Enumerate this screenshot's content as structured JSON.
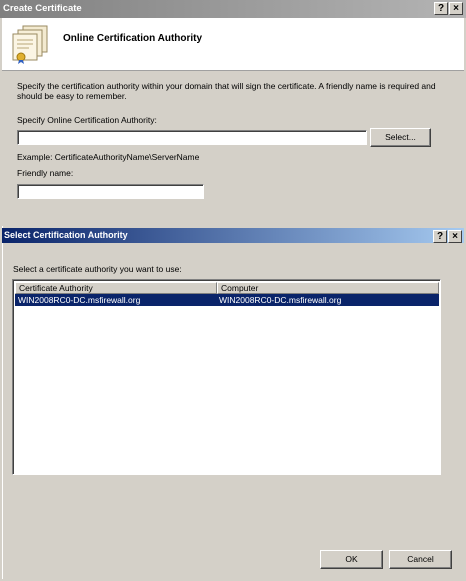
{
  "outer": {
    "title": "Create Certificate",
    "help_glyph": "?",
    "close_glyph": "×",
    "header_title": "Online Certification Authority",
    "description": "Specify the certification authority within your domain that will sign the certificate. A friendly name is required and should be easy to remember.",
    "ca_label": "Specify Online Certification Authority:",
    "ca_value": "",
    "select_button": "Select...",
    "example": "Example: CertificateAuthorityName\\ServerName",
    "friendly_label": "Friendly name:",
    "friendly_value": ""
  },
  "inner": {
    "title": "Select Certification Authority",
    "help_glyph": "?",
    "close_glyph": "×",
    "prompt": "Select a certificate authority you want to use:",
    "columns": [
      "Certificate Authority",
      "Computer"
    ],
    "rows": [
      {
        "authority": "WIN2008RC0-DC.msfirewall.org",
        "computer": "WIN2008RC0-DC.msfirewall.org",
        "selected": true
      }
    ],
    "ok_button": "OK",
    "cancel_button": "Cancel"
  }
}
